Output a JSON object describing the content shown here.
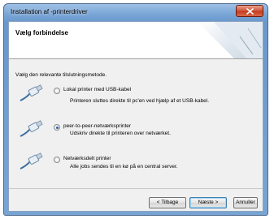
{
  "window": {
    "title": "Installation af -printerdriver"
  },
  "header": {
    "title": "Vælg forbindelse"
  },
  "intro": "Vælg den relevante tilslutningsmetode.",
  "options": [
    {
      "label": "Lokal printer med USB-kabel",
      "description": "Printeren sluttes direkte til pc'en ved hjælp af et USB-kabel.",
      "selected": false,
      "icon": "usb-cable-icon"
    },
    {
      "label": "peer-to-peer-netværksprinter",
      "description": "Udskriv direkte til printeren over netværket.",
      "selected": true,
      "icon": "network-cable-icon"
    },
    {
      "label": "Netværksdelt printer",
      "description": "Alle jobs sendes til en kø på en central server.",
      "selected": false,
      "icon": "network-cable-icon"
    }
  ],
  "buttons": {
    "back": "< Tilbage",
    "next": "Næste >",
    "cancel": "Annuller"
  }
}
